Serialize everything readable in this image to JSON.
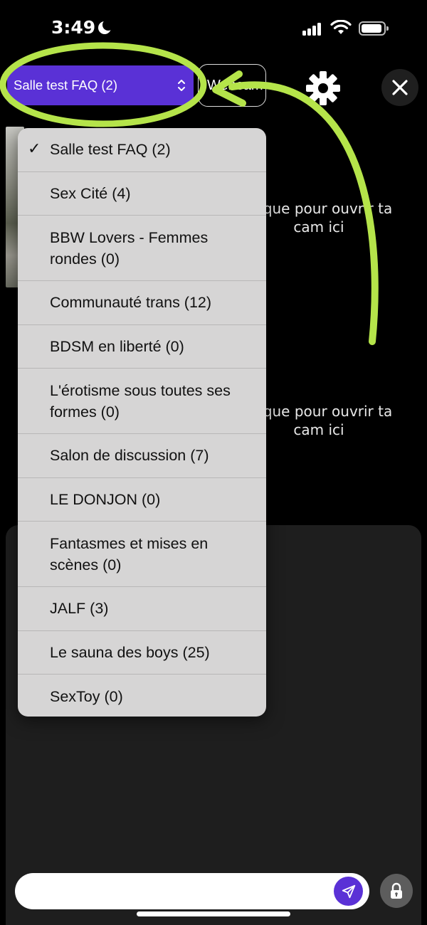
{
  "status_bar": {
    "time": "3:49"
  },
  "header": {
    "room_select_label": "Salle test FAQ (2)",
    "webcam_label": "Webcam"
  },
  "cam_tiles": [
    {
      "text": "Clique pour ouvrir ta cam ici"
    },
    {
      "text": "Clique pour ouvrir ta cam ici"
    }
  ],
  "room_menu": {
    "items": [
      {
        "label": "Salle test FAQ (2)",
        "selected": true
      },
      {
        "label": "Sex Cité (4)"
      },
      {
        "label": "BBW Lovers - Femmes rondes (0)"
      },
      {
        "label": "Communauté trans (12)"
      },
      {
        "label": "BDSM en liberté (0)"
      },
      {
        "label": "L'érotisme sous toutes ses formes (0)"
      },
      {
        "label": "Salon de discussion (7)"
      },
      {
        "label": "LE DONJON (0)"
      },
      {
        "label": "Fantasmes et mises en scènes (0)"
      },
      {
        "label": "JALF (3)"
      },
      {
        "label": "Le sauna des boys (25)"
      },
      {
        "label": "SexToy (0)"
      }
    ]
  },
  "chat": {
    "input_value": "",
    "input_placeholder": ""
  },
  "icons": {
    "settings": "gear-icon",
    "close": "close-icon",
    "send": "send-icon",
    "lock": "lock-icon",
    "select_arrows": "chevron-up-down-icon",
    "check": "checkmark-icon"
  },
  "colors": {
    "accent": "#5a31d6",
    "annotation": "#b5e44a",
    "menu_bg": "#d6d5d5",
    "background": "#000000"
  }
}
